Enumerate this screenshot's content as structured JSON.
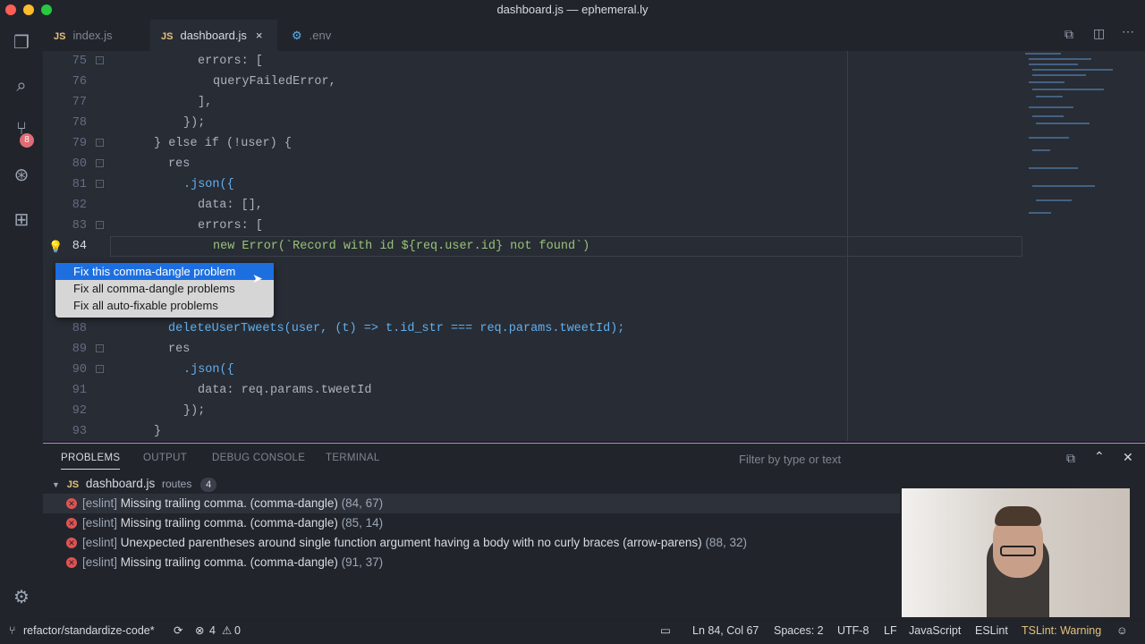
{
  "window": {
    "title": "dashboard.js — ephemeral.ly"
  },
  "activity": {
    "scm_badge": "8"
  },
  "tabs": [
    {
      "icon": "JS",
      "label": "index.js"
    },
    {
      "icon": "JS",
      "label": "dashboard.js",
      "close": "×"
    },
    {
      "icon": "gear",
      "label": ".env"
    }
  ],
  "editor": {
    "lines": [
      {
        "n": "75",
        "text": "errors: ["
      },
      {
        "n": "76",
        "text": "queryFailedError,"
      },
      {
        "n": "77",
        "text": "],"
      },
      {
        "n": "78",
        "text": "});"
      },
      {
        "n": "79",
        "text": "} else if (!user) {"
      },
      {
        "n": "80",
        "text": "res"
      },
      {
        "n": "81",
        "text": ".json({"
      },
      {
        "n": "82",
        "text": "data: [],"
      },
      {
        "n": "83",
        "text": "errors: ["
      },
      {
        "n": "84",
        "text": "new Error(`Record with id ${req.user.id} not found`)"
      },
      {
        "n": "88",
        "text": "deleteUserTweets(user, (t) => t.id_str === req.params.tweetId);"
      },
      {
        "n": "89",
        "text": "res"
      },
      {
        "n": "90",
        "text": ".json({"
      },
      {
        "n": "91",
        "text": "data: req.params.tweetId"
      },
      {
        "n": "92",
        "text": "});"
      },
      {
        "n": "93",
        "text": "}"
      }
    ]
  },
  "quickfix": {
    "items": [
      "Fix this comma-dangle problem",
      "Fix all comma-dangle problems",
      "Fix all auto-fixable problems"
    ]
  },
  "panel": {
    "tabs": [
      "PROBLEMS",
      "OUTPUT",
      "DEBUG CONSOLE",
      "TERMINAL"
    ],
    "filter_placeholder": "Filter by type or text",
    "file": {
      "name": "dashboard.js",
      "folder": "routes",
      "count": "4"
    },
    "problems": [
      {
        "source": "[eslint]",
        "msg": "Missing trailing comma. (comma-dangle)",
        "loc": "(84, 67)"
      },
      {
        "source": "[eslint]",
        "msg": "Missing trailing comma. (comma-dangle)",
        "loc": "(85, 14)"
      },
      {
        "source": "[eslint]",
        "msg": "Unexpected parentheses around single function argument having a body with no curly braces (arrow-parens)",
        "loc": "(88, 32)"
      },
      {
        "source": "[eslint]",
        "msg": "Missing trailing comma. (comma-dangle)",
        "loc": "(91, 37)"
      }
    ]
  },
  "statusbar": {
    "branch": "refactor/standardize-code*",
    "errors": "4",
    "warnings": "0",
    "position": "Ln 84, Col 67",
    "spaces": "Spaces: 2",
    "encoding": "UTF-8",
    "eol": "LF",
    "language": "JavaScript",
    "eslint": "ESLint",
    "tslint": "TSLint: Warning"
  },
  "colors": {
    "accent": "#c678dd",
    "selection": "#1d6fe0",
    "error": "#e05252",
    "tslint": "#e5c07b"
  }
}
